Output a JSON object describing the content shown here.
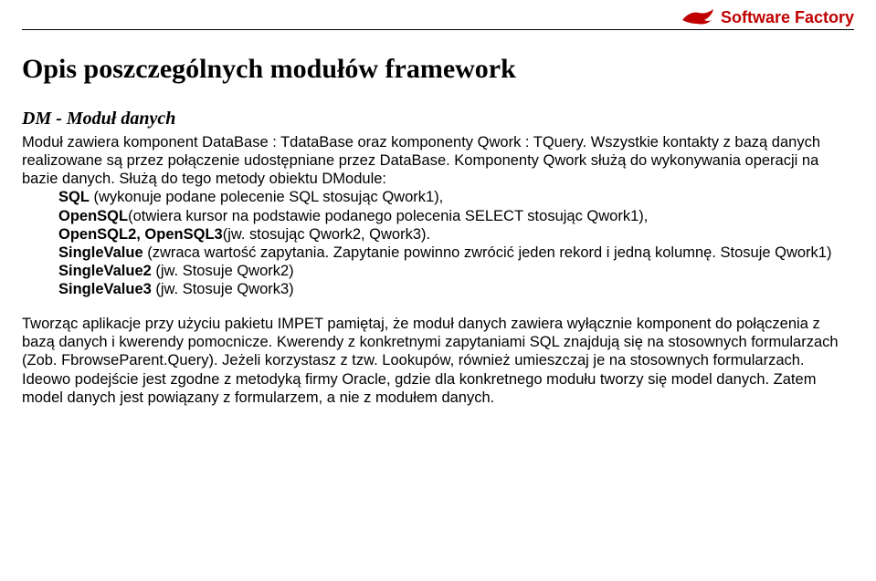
{
  "header": {
    "brand": "Software Factory"
  },
  "title": "Opis poszczególnych modułów framework",
  "section_title": "DM - Moduł danych",
  "p1": "Moduł zawiera komponent DataBase : TdataBase oraz komponenty Qwork : TQuery. Wszystkie kontakty z bazą danych realizowane są przez połączenie udostępniane przez DataBase. Komponenty Qwork służą do wykonywania operacji na bazie danych. Służą do tego metody obiektu DModule:",
  "m1a": "SQL",
  "m1b": " (wykonuje podane polecenie SQL stosując Qwork1),",
  "m2a": "OpenSQL",
  "m2b": "(otwiera kursor na podstawie podanego polecenia SELECT stosując Qwork1),",
  "m3a": "OpenSQL2, OpenSQL3",
  "m3b": "(jw. stosując Qwork2, Qwork3).",
  "m4a": "SingleValue",
  "m4b": " (zwraca wartość zapytania. Zapytanie powinno zwrócić jeden rekord i jedną kolumnę. Stosuje Qwork1)",
  "m5a": "SingleValue2",
  "m5b": " (jw. Stosuje Qwork2)",
  "m6a": "SingleValue3",
  "m6b": " (jw. Stosuje Qwork3)",
  "p2": "Tworząc aplikacje przy użyciu pakietu IMPET pamiętaj, że moduł danych zawiera wyłącznie komponent do połączenia z bazą danych i kwerendy pomocnicze. Kwerendy z konkretnymi zapytaniami SQL znajdują się na stosownych formularzach (Zob. FbrowseParent.Query). Jeżeli korzystasz z tzw. Lookupów, również umieszczaj je na stosownych formularzach. Ideowo podejście jest zgodne z metodyką firmy Oracle, gdzie dla konkretnego modułu tworzy się model danych. Zatem model danych jest powiązany z formularzem, a nie z modułem danych."
}
